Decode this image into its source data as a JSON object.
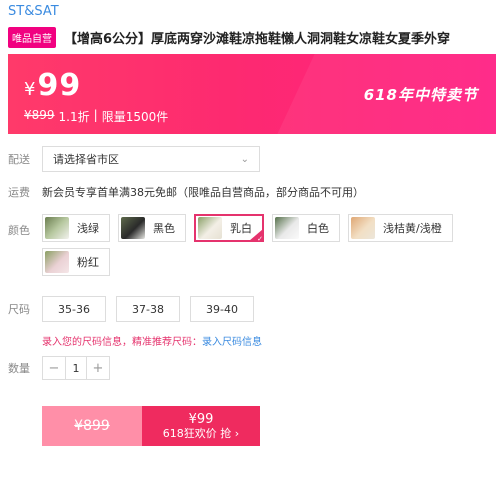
{
  "brand": "ST&SAT",
  "badge": "唯品自营",
  "product_title": "【增高6公分】厚底两穿沙滩鞋凉拖鞋懒人洞洞鞋女凉鞋女夏季外穿",
  "promo": {
    "currency": "¥",
    "price": "99",
    "original_price": "¥899",
    "discount": "1.1折",
    "separator": "|",
    "limit": "限量1500件",
    "festival": "618年中特卖节"
  },
  "delivery": {
    "label": "配送",
    "placeholder": "请选择省市区",
    "chevron": "chevron-down-icon"
  },
  "shipping": {
    "label": "运费",
    "text": "新会员专享首单满38元免邮（限唯品自营商品，部分商品不可用）"
  },
  "colors": {
    "label": "颜色",
    "options": [
      {
        "name": "浅绿",
        "selected": false
      },
      {
        "name": "黑色",
        "selected": false
      },
      {
        "name": "乳白",
        "selected": true
      },
      {
        "name": "白色",
        "selected": false
      },
      {
        "name": "浅桔黄/浅橙",
        "selected": false
      },
      {
        "name": "粉红",
        "selected": false
      }
    ]
  },
  "sizes": {
    "label": "尺码",
    "options": [
      "35-36",
      "37-38",
      "39-40"
    ]
  },
  "size_hint": {
    "text": "录入您的尺码信息，精准推荐尺码：",
    "link": "录入尺码信息"
  },
  "quantity": {
    "label": "数量",
    "minus": "−",
    "value": "1",
    "plus": "+"
  },
  "buy": {
    "original": "¥899",
    "price": "¥99",
    "label": "618狂欢价 抢 ›"
  },
  "colors_theme": {
    "accent": "#f10180",
    "buy": "#ef2b5f",
    "link": "#3b8be0"
  }
}
